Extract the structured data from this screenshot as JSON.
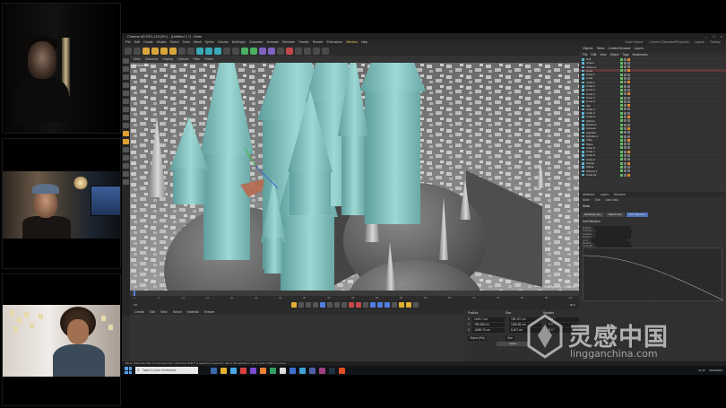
{
  "app": {
    "title": "Cinema 4D R21.115 (RC) - [Untitled 1 *] - Main",
    "menus": [
      "File",
      "Edit",
      "Create",
      "Modes",
      "Select",
      "Tools",
      "Mesh",
      "Spline",
      "Volume",
      "MoGraph",
      "Character",
      "Animate",
      "Simulate",
      "Tracker",
      "Render",
      "Extensions",
      "Window",
      "Help"
    ],
    "highlighted_menu": "Window",
    "layout_label": "Node Space:",
    "layout_value": "Current (Standard/Physical)",
    "layout_mode_label": "Layout:",
    "layout_mode_value": "Startup"
  },
  "viewport": {
    "menus": [
      "View",
      "Cameras",
      "Display",
      "Options",
      "Filter",
      "Panel"
    ],
    "camera_label": "Perspective",
    "grid_spacing": "Grid Spacing : 1000 cm"
  },
  "timeline": {
    "frames": [
      "0",
      "5",
      "10",
      "15",
      "20",
      "25",
      "30",
      "35",
      "40",
      "45",
      "50",
      "55",
      "60",
      "65",
      "70",
      "75",
      "80",
      "85",
      "90"
    ],
    "current_frame": "0 F",
    "end_frame": "90 F"
  },
  "lower_panel": {
    "tabs": [
      "Create",
      "Edit",
      "View",
      "Select",
      "Material",
      "Texture"
    ]
  },
  "coordinates": {
    "headers": [
      "Position",
      "Size",
      "Rotation"
    ],
    "rows": [
      {
        "axis": "X",
        "pos": "1425.7 cm",
        "size": "780.127 cm",
        "rot": "H 0 °"
      },
      {
        "axis": "Y",
        "pos": "789.085 cm",
        "size": "1186.89 cm",
        "rot": "P 0 °"
      },
      {
        "axis": "Z",
        "pos": "-6565.76 cm",
        "size": "8.407 cm",
        "rot": "B 0 °"
      }
    ],
    "mode_object": "Object (Rel)",
    "mode_size": "Size",
    "apply": "Apply"
  },
  "objects": {
    "tabs": [
      "Objects",
      "Takes",
      "Content Browser",
      "Layers"
    ],
    "menu": [
      "File",
      "Edit",
      "View",
      "Object",
      "Tags",
      "Bookmarks"
    ],
    "items": [
      "Null",
      "Cloner",
      "Cloner.1",
      "Cone",
      "Cone.1",
      "Cube",
      "Cube.1",
      "Cube.2",
      "Cone.2",
      "Cone.3",
      "Cone.4",
      "Cone.5",
      "Sky",
      "Cube.3",
      "Cube.4",
      "Cube.5",
      "Sphere",
      "Random",
      "Camera",
      "Cylinder",
      "Cylinder.1",
      "Tube",
      "Plane",
      "Cube.6",
      "Cube.7",
      "Cube.8",
      "Cube.9",
      "Sweep",
      "Spline",
      "Sphere.1",
      "Cube.10"
    ],
    "selected_index": 3
  },
  "attributes": {
    "tabs": [
      "Attributes",
      "Layers",
      "Structure"
    ],
    "menu": [
      "Mode",
      "Edit",
      "User Data"
    ],
    "title": "Mesh",
    "buttons": [
      "Modeling Axis",
      "Object Axis",
      "Soft Selection"
    ],
    "active_button": "Soft Selection",
    "section": "Soft Selection",
    "fields": [
      "Enable",
      "Preview",
      "Surface",
      "Rubber",
      "Limit",
      "Radius",
      "Strength",
      "Width",
      "Falloff"
    ]
  },
  "status": {
    "text": "Move: Click and drag to move elements. Hold down SHIFT to quantize movement / add to the selection in point mode. CTRL to remove."
  },
  "taskbar": {
    "search_placeholder": "Taper ici pour rechercher",
    "time": "21:17",
    "date": "23/04/2021"
  },
  "watermark": {
    "title": "灵感中国",
    "subtitle": "lingganchina.com"
  },
  "colors": {
    "accent_blue": "#4f7fe0",
    "accent_yellow": "#e0a030",
    "cone_teal": "#8ccfcb"
  }
}
